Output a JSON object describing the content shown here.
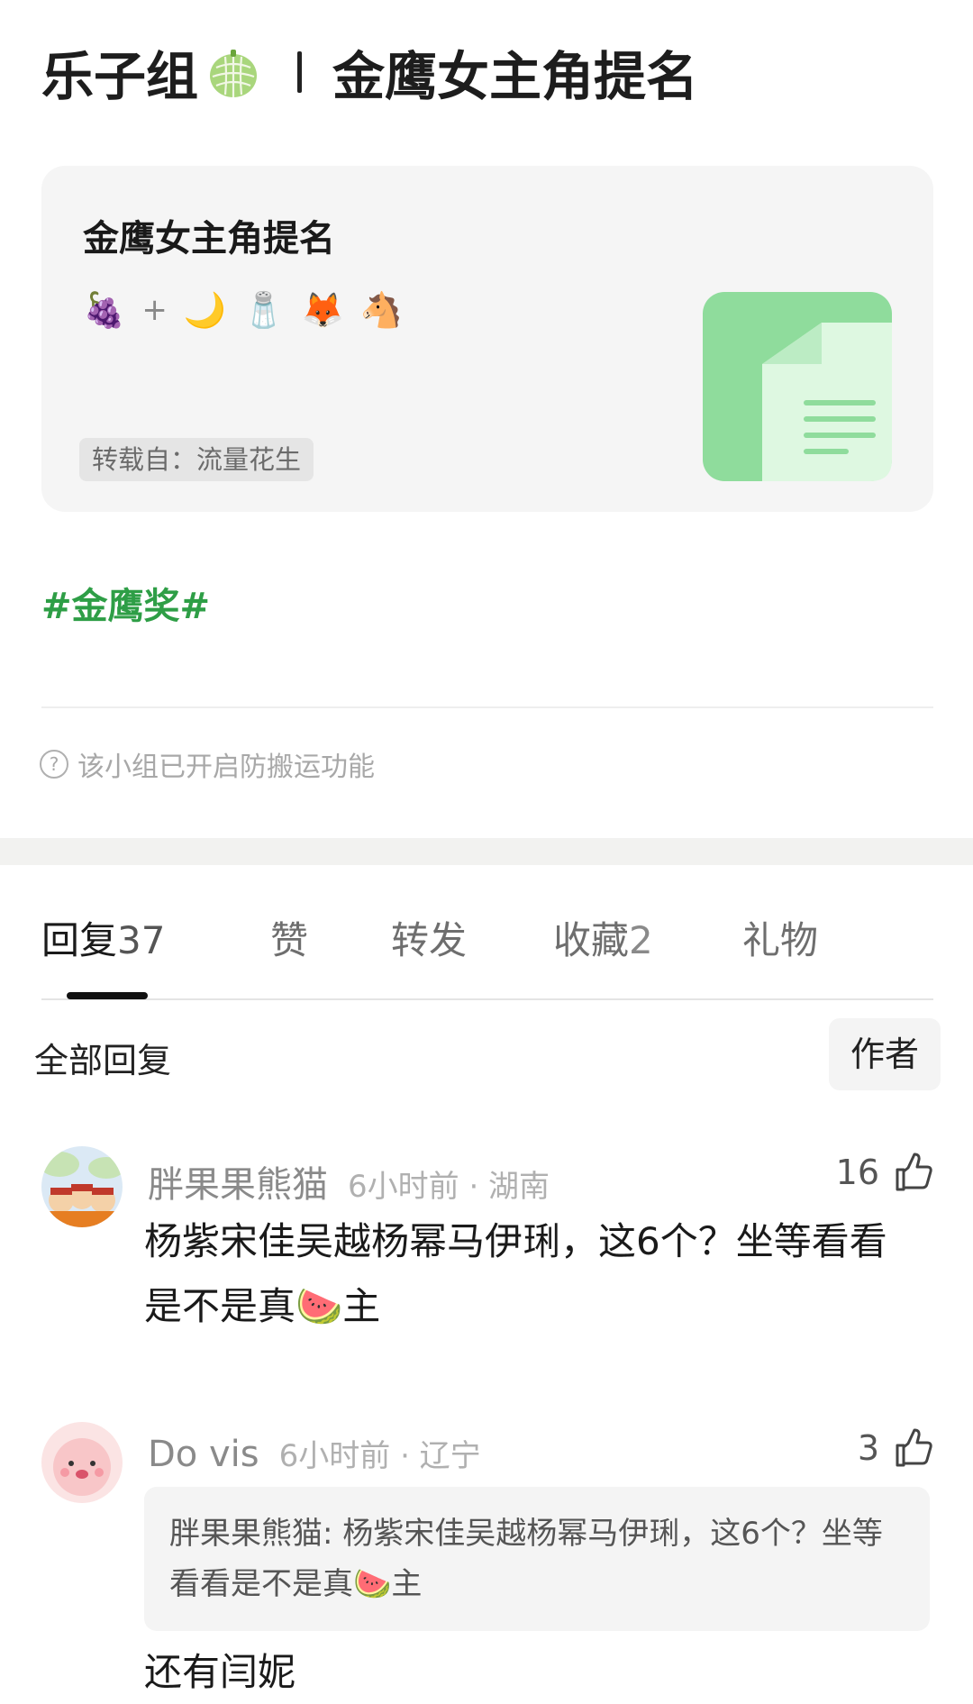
{
  "header": {
    "group": "乐子组",
    "title": "金鹰女主角提名"
  },
  "card": {
    "title": "金鹰女主角提名",
    "emojis": [
      "🍇",
      "+",
      "🌙",
      "🧂",
      "🦊",
      "🐴"
    ],
    "repost": "转载自：流量花生"
  },
  "hashtag": "#金鹰奖#",
  "notice": "该小组已开启防搬运功能",
  "tabs": [
    {
      "label": "回复",
      "count": "37"
    },
    {
      "label": "赞",
      "count": ""
    },
    {
      "label": "转发",
      "count": ""
    },
    {
      "label": "收藏",
      "count": "2"
    },
    {
      "label": "礼物",
      "count": ""
    }
  ],
  "replies": {
    "label": "全部回复",
    "author_button": "作者"
  },
  "comments": [
    {
      "name": "胖果果熊猫",
      "time_loc": "6小时前 · 湖南",
      "likes": "16",
      "text": "杨紫宋佳吴越杨幂马伊琍，这6个？坐等看看是不是真🍉主"
    },
    {
      "name": "Do vis",
      "time_loc": "6小时前 · 辽宁",
      "likes": "3",
      "quote": "胖果果熊猫: 杨紫宋佳吴越杨幂马伊琍，这6个？坐等看看是不是真🍉主",
      "text": "还有闫妮"
    }
  ],
  "colors": {
    "hashtag": "#2e9e46",
    "doc_icon": "#8fdc9c"
  }
}
